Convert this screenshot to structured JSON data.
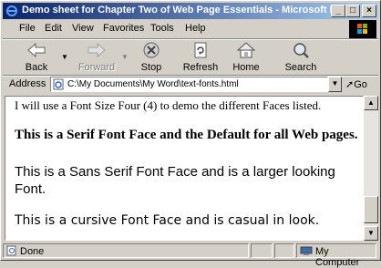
{
  "window": {
    "title": "Demo sheet for Chapter Two of Web Page Essentials - Microsoft In..."
  },
  "titlebar_buttons": {
    "minimize": "_",
    "maximize": "□",
    "close": "×"
  },
  "menu": [
    {
      "label": "File"
    },
    {
      "label": "Edit"
    },
    {
      "label": "View"
    },
    {
      "label": "Favorites"
    },
    {
      "label": "Tools"
    },
    {
      "label": "Help"
    }
  ],
  "toolbar": {
    "back": "Back",
    "forward": "Forward",
    "stop": "Stop",
    "refresh": "Refresh",
    "home": "Home",
    "search": "Search"
  },
  "address": {
    "label": "Address",
    "value": "C:\\My Documents\\My Word\\text-fonts.html",
    "go": "Go"
  },
  "content": {
    "line1": "I will use a Font Size Four (4) to demo the different Faces listed.",
    "line2": "This is a Serif Font Face and the Default for all Web pages.",
    "line3": "This is a Sans Serif Font Face and is a larger looking Font.",
    "line4": "This is a cursive Font Face and is casual in look."
  },
  "status": {
    "text": "Done",
    "zone": "My Computer"
  },
  "icons": {
    "back": "back-arrow-icon",
    "forward": "forward-arrow-icon",
    "stop": "stop-icon",
    "refresh": "refresh-icon",
    "home": "home-icon",
    "search": "search-icon"
  },
  "colors": {
    "titlebar_start": "#0a246a",
    "titlebar_end": "#a6caf0",
    "chrome": "#d4d0c8"
  }
}
